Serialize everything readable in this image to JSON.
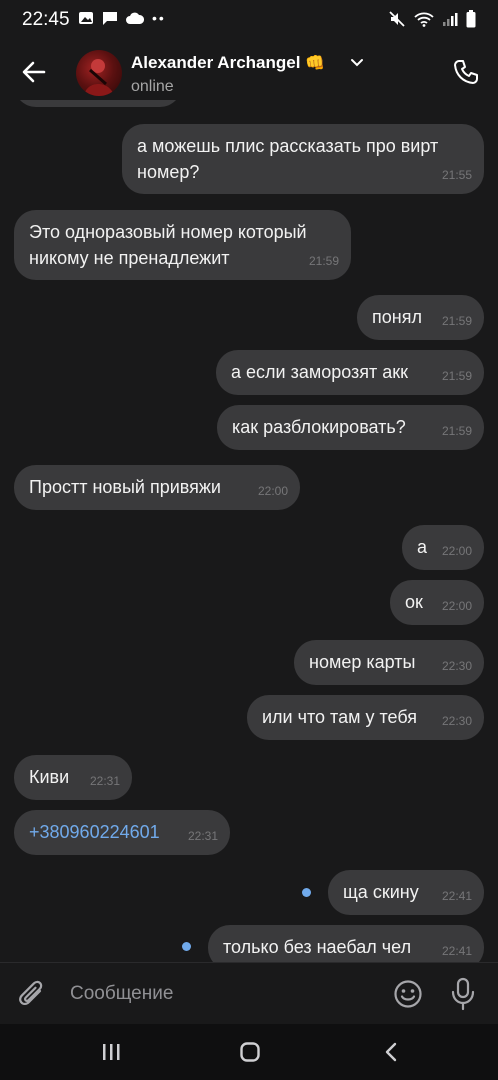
{
  "status_bar": {
    "time": "22:45"
  },
  "header": {
    "name": "Alexander Archangel",
    "emoji": "👊",
    "presence": "online"
  },
  "messages": [
    {
      "dir": "out",
      "lines": [
        "а можешь плис рассказать про вирт",
        "номер?"
      ],
      "time": "21:55"
    },
    {
      "dir": "in",
      "lines": [
        "Это одноразовый номер который",
        "никому не  пренадлежит"
      ],
      "time": "21:59"
    },
    {
      "dir": "out",
      "text": "понял",
      "time": "21:59"
    },
    {
      "dir": "out",
      "text": "а если заморозят акк",
      "time": "21:59"
    },
    {
      "dir": "out",
      "text": "как разблокировать?",
      "time": "21:59"
    },
    {
      "dir": "in",
      "text": "Простт новый привяжи",
      "time": "22:00"
    },
    {
      "dir": "out",
      "text": "а",
      "time": "22:00"
    },
    {
      "dir": "out",
      "text": "ок",
      "time": "22:00"
    },
    {
      "dir": "out",
      "text": "номер карты",
      "time": "22:30"
    },
    {
      "dir": "out",
      "text": "или что там у тебя",
      "time": "22:30"
    },
    {
      "dir": "in",
      "text": "Киви",
      "time": "22:31"
    },
    {
      "dir": "in",
      "text": "+380960224601",
      "time": "22:31",
      "is_link": true
    },
    {
      "dir": "out",
      "text": "ща скину",
      "time": "22:41",
      "unread": true
    },
    {
      "dir": "out",
      "text": "только без наебал чел",
      "time": "22:41",
      "unread": true
    }
  ],
  "composer": {
    "placeholder": "Сообщение"
  },
  "colors": {
    "background": "#19191a",
    "bubble": "#3a3a3c",
    "accent": "#71aaeb"
  }
}
